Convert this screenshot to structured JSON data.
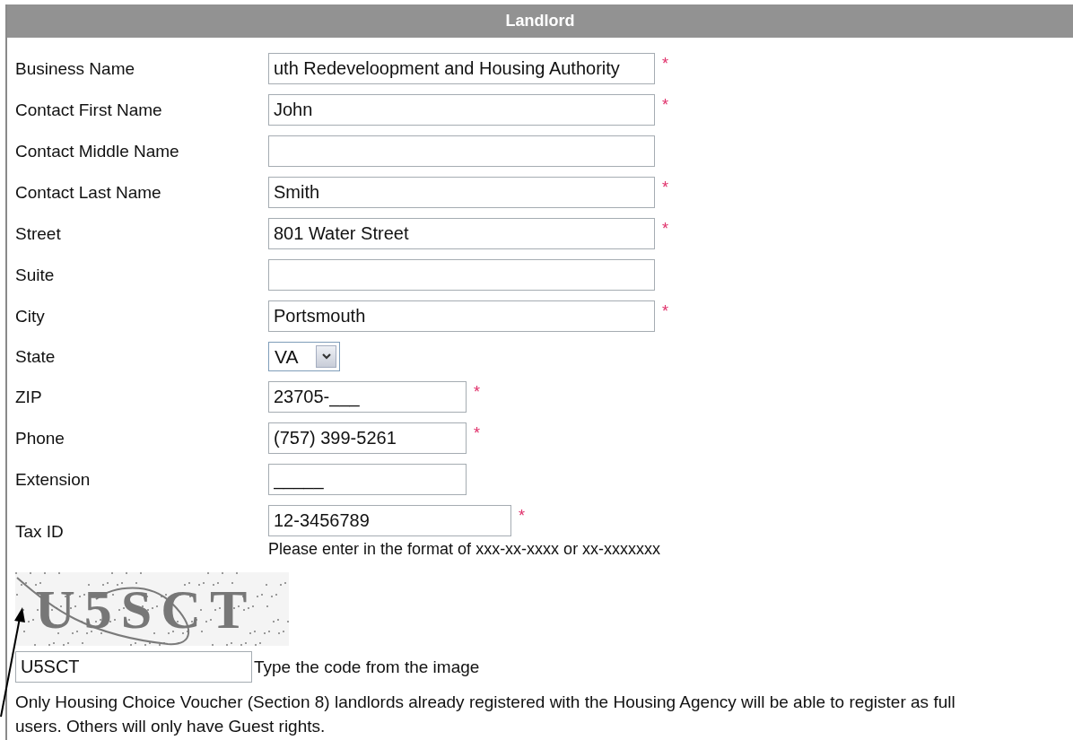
{
  "panel": {
    "title": "Landlord"
  },
  "fields": [
    {
      "kind": "wide",
      "label": "Business Name",
      "value": "uth Redeveloopment and Housing Authority",
      "marker": "*"
    },
    {
      "kind": "wide",
      "label": "Contact First Name",
      "value": "John",
      "marker": "*"
    },
    {
      "kind": "wide",
      "label": "Contact Middle Name"
    },
    {
      "kind": "wide",
      "label": "Contact Last Name",
      "value": "Smith",
      "marker": "*"
    },
    {
      "kind": "wide",
      "label": "Street",
      "value": "801 Water Street",
      "marker": "*"
    },
    {
      "kind": "wide",
      "label": "Suite"
    },
    {
      "kind": "wide",
      "label": "City",
      "value": "Portsmouth",
      "marker": "*"
    },
    {
      "kind": "select",
      "label": "State",
      "value": "VA"
    },
    {
      "kind": "narrow",
      "label": "ZIP",
      "value": "23705-___",
      "marker": "*"
    },
    {
      "kind": "narrow",
      "label": "Phone",
      "value": "(757) 399-5261",
      "marker": "*"
    },
    {
      "kind": "narrow",
      "label": "Extension",
      "value": "_____"
    },
    {
      "kind": "medium",
      "label": "Tax ID",
      "value": "12-3456789",
      "marker": "*",
      "hint": "Please enter in the format of xxx-xx-xxxx or xx-xxxxxxx"
    }
  ],
  "captcha": {
    "code": "U5SCT",
    "value": "U5SCT",
    "instruction": "Type the code from the image"
  },
  "notice": "Only Housing Choice Voucher (Section 8) landlords already registered with the Housing Agency will be able to register as full users. Others will only have Guest rights."
}
